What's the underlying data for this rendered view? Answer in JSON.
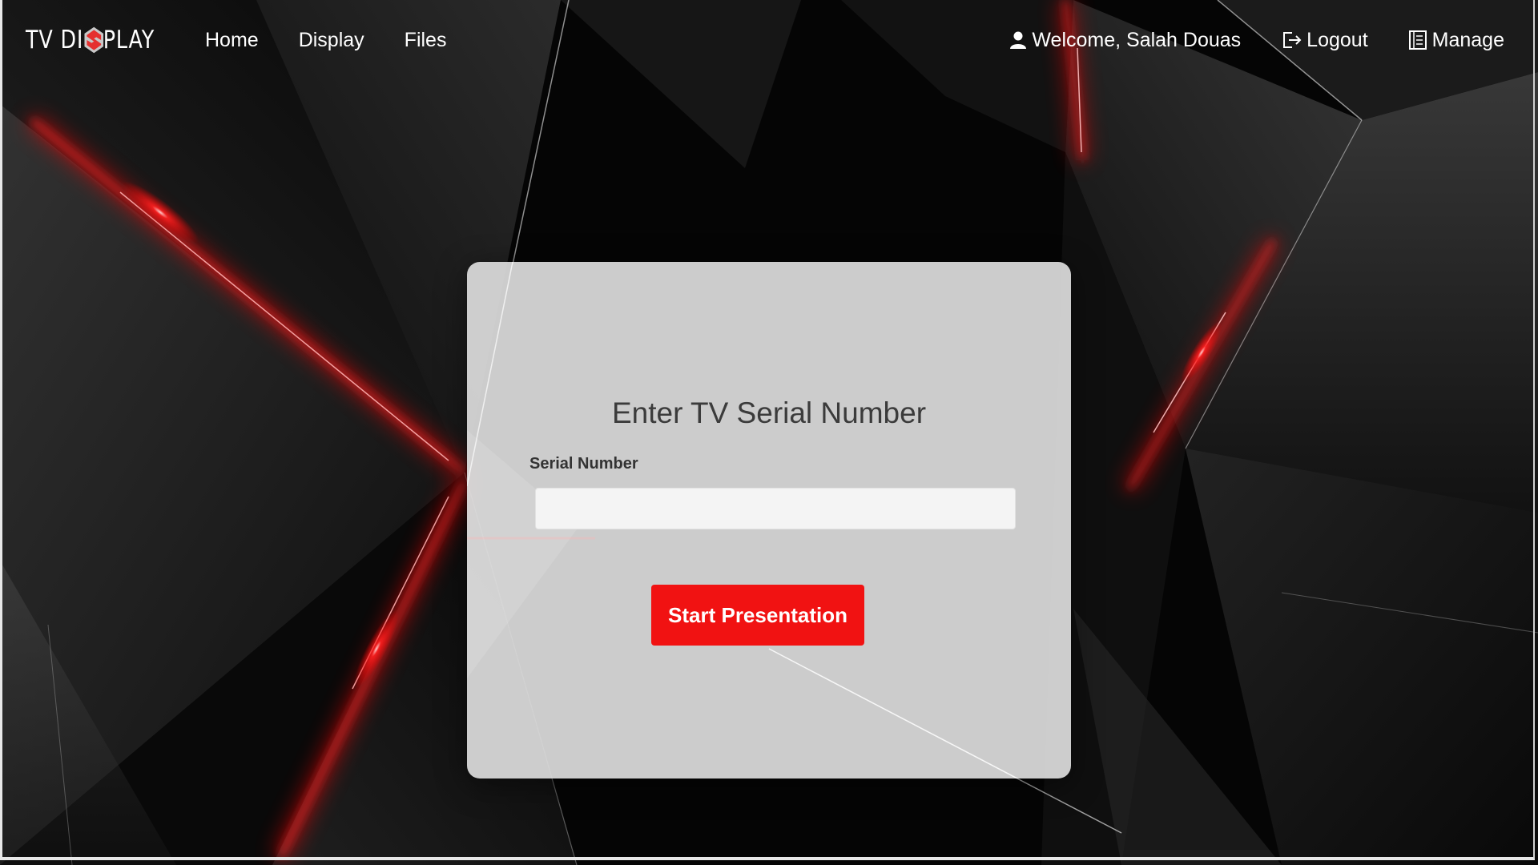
{
  "brand": {
    "name_left": "TV DI",
    "name_right": "PLAY",
    "logo_icon": "s-shape-logo-icon",
    "logo_color": "#e5302f"
  },
  "nav": {
    "links": [
      "Home",
      "Display",
      "Files"
    ],
    "welcome": "Welcome, Salah Douas",
    "logout": "Logout",
    "manage": "Manage"
  },
  "card": {
    "title": "Enter TV Serial Number",
    "field_label": "Serial Number",
    "input_value": "",
    "input_placeholder": "",
    "button_label": "Start Presentation",
    "button_color": "#f11212"
  },
  "theme": {
    "background": "#050505",
    "accent": "#ff1a1a"
  }
}
